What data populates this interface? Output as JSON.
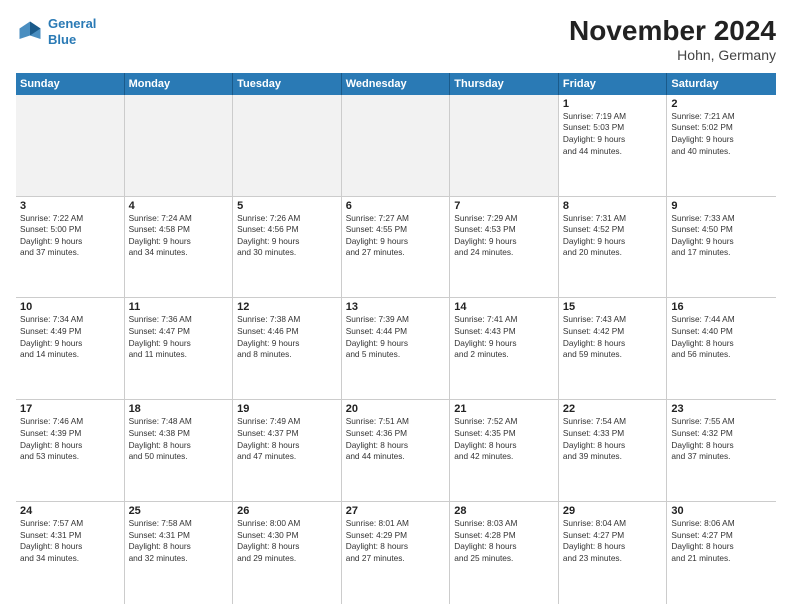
{
  "header": {
    "logo_line1": "General",
    "logo_line2": "Blue",
    "title": "November 2024",
    "subtitle": "Hohn, Germany"
  },
  "weekdays": [
    "Sunday",
    "Monday",
    "Tuesday",
    "Wednesday",
    "Thursday",
    "Friday",
    "Saturday"
  ],
  "weeks": [
    [
      {
        "day": "",
        "info": ""
      },
      {
        "day": "",
        "info": ""
      },
      {
        "day": "",
        "info": ""
      },
      {
        "day": "",
        "info": ""
      },
      {
        "day": "",
        "info": ""
      },
      {
        "day": "1",
        "info": "Sunrise: 7:19 AM\nSunset: 5:03 PM\nDaylight: 9 hours\nand 44 minutes."
      },
      {
        "day": "2",
        "info": "Sunrise: 7:21 AM\nSunset: 5:02 PM\nDaylight: 9 hours\nand 40 minutes."
      }
    ],
    [
      {
        "day": "3",
        "info": "Sunrise: 7:22 AM\nSunset: 5:00 PM\nDaylight: 9 hours\nand 37 minutes."
      },
      {
        "day": "4",
        "info": "Sunrise: 7:24 AM\nSunset: 4:58 PM\nDaylight: 9 hours\nand 34 minutes."
      },
      {
        "day": "5",
        "info": "Sunrise: 7:26 AM\nSunset: 4:56 PM\nDaylight: 9 hours\nand 30 minutes."
      },
      {
        "day": "6",
        "info": "Sunrise: 7:27 AM\nSunset: 4:55 PM\nDaylight: 9 hours\nand 27 minutes."
      },
      {
        "day": "7",
        "info": "Sunrise: 7:29 AM\nSunset: 4:53 PM\nDaylight: 9 hours\nand 24 minutes."
      },
      {
        "day": "8",
        "info": "Sunrise: 7:31 AM\nSunset: 4:52 PM\nDaylight: 9 hours\nand 20 minutes."
      },
      {
        "day": "9",
        "info": "Sunrise: 7:33 AM\nSunset: 4:50 PM\nDaylight: 9 hours\nand 17 minutes."
      }
    ],
    [
      {
        "day": "10",
        "info": "Sunrise: 7:34 AM\nSunset: 4:49 PM\nDaylight: 9 hours\nand 14 minutes."
      },
      {
        "day": "11",
        "info": "Sunrise: 7:36 AM\nSunset: 4:47 PM\nDaylight: 9 hours\nand 11 minutes."
      },
      {
        "day": "12",
        "info": "Sunrise: 7:38 AM\nSunset: 4:46 PM\nDaylight: 9 hours\nand 8 minutes."
      },
      {
        "day": "13",
        "info": "Sunrise: 7:39 AM\nSunset: 4:44 PM\nDaylight: 9 hours\nand 5 minutes."
      },
      {
        "day": "14",
        "info": "Sunrise: 7:41 AM\nSunset: 4:43 PM\nDaylight: 9 hours\nand 2 minutes."
      },
      {
        "day": "15",
        "info": "Sunrise: 7:43 AM\nSunset: 4:42 PM\nDaylight: 8 hours\nand 59 minutes."
      },
      {
        "day": "16",
        "info": "Sunrise: 7:44 AM\nSunset: 4:40 PM\nDaylight: 8 hours\nand 56 minutes."
      }
    ],
    [
      {
        "day": "17",
        "info": "Sunrise: 7:46 AM\nSunset: 4:39 PM\nDaylight: 8 hours\nand 53 minutes."
      },
      {
        "day": "18",
        "info": "Sunrise: 7:48 AM\nSunset: 4:38 PM\nDaylight: 8 hours\nand 50 minutes."
      },
      {
        "day": "19",
        "info": "Sunrise: 7:49 AM\nSunset: 4:37 PM\nDaylight: 8 hours\nand 47 minutes."
      },
      {
        "day": "20",
        "info": "Sunrise: 7:51 AM\nSunset: 4:36 PM\nDaylight: 8 hours\nand 44 minutes."
      },
      {
        "day": "21",
        "info": "Sunrise: 7:52 AM\nSunset: 4:35 PM\nDaylight: 8 hours\nand 42 minutes."
      },
      {
        "day": "22",
        "info": "Sunrise: 7:54 AM\nSunset: 4:33 PM\nDaylight: 8 hours\nand 39 minutes."
      },
      {
        "day": "23",
        "info": "Sunrise: 7:55 AM\nSunset: 4:32 PM\nDaylight: 8 hours\nand 37 minutes."
      }
    ],
    [
      {
        "day": "24",
        "info": "Sunrise: 7:57 AM\nSunset: 4:31 PM\nDaylight: 8 hours\nand 34 minutes."
      },
      {
        "day": "25",
        "info": "Sunrise: 7:58 AM\nSunset: 4:31 PM\nDaylight: 8 hours\nand 32 minutes."
      },
      {
        "day": "26",
        "info": "Sunrise: 8:00 AM\nSunset: 4:30 PM\nDaylight: 8 hours\nand 29 minutes."
      },
      {
        "day": "27",
        "info": "Sunrise: 8:01 AM\nSunset: 4:29 PM\nDaylight: 8 hours\nand 27 minutes."
      },
      {
        "day": "28",
        "info": "Sunrise: 8:03 AM\nSunset: 4:28 PM\nDaylight: 8 hours\nand 25 minutes."
      },
      {
        "day": "29",
        "info": "Sunrise: 8:04 AM\nSunset: 4:27 PM\nDaylight: 8 hours\nand 23 minutes."
      },
      {
        "day": "30",
        "info": "Sunrise: 8:06 AM\nSunset: 4:27 PM\nDaylight: 8 hours\nand 21 minutes."
      }
    ]
  ]
}
